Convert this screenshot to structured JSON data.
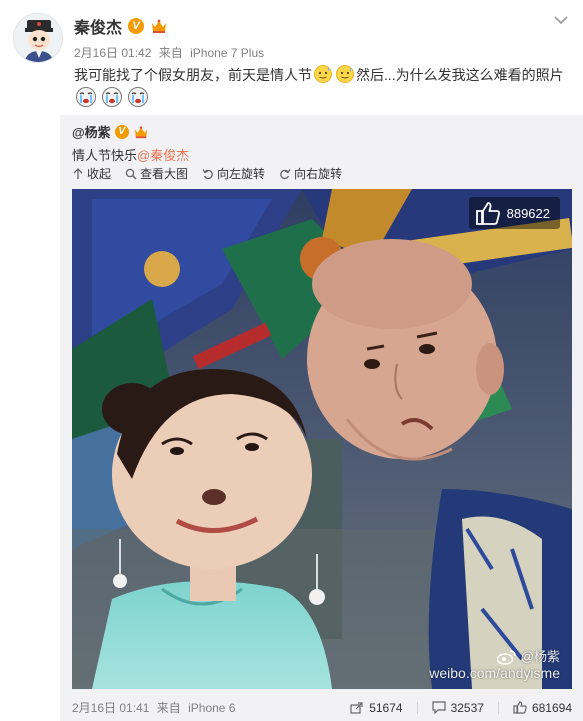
{
  "post": {
    "author": "秦俊杰",
    "verified_badge": "V",
    "time": "2月16日 01:42",
    "via_prefix": "来自",
    "device": "iPhone 7 Plus",
    "text_part1": "我可能找了个假女朋友，前天是情人节",
    "text_part2": "然后...为什么发我这么难看的照片",
    "icons": {
      "avatar": "cartoon-avatar",
      "menu": "chevron-down-icon",
      "crown": "crown-icon",
      "emoji_sweat": "sweat-smile-emoji",
      "emoji_cry": "crying-face-emoji"
    }
  },
  "repost": {
    "author": "@杨紫",
    "verified_badge": "V",
    "text": "情人节快乐",
    "mention": "@秦俊杰",
    "toolbar": {
      "collapse": "收起",
      "view_large": "查看大图",
      "rotate_left": "向左旋转",
      "rotate_right": "向右旋转"
    },
    "photo": {
      "like_count": "889622",
      "watermark_user": "@杨紫",
      "watermark_url": "weibo.com/andyisme"
    },
    "footer": {
      "time": "2月16日 01:41",
      "via_prefix": "来自",
      "device": "iPhone 6",
      "reposts": "51674",
      "comments": "32537",
      "likes": "681694"
    }
  },
  "colors": {
    "mention": "#eb7350",
    "badge": "#f59a00",
    "repost_bg": "#f2f2f5",
    "meta": "#808080"
  }
}
